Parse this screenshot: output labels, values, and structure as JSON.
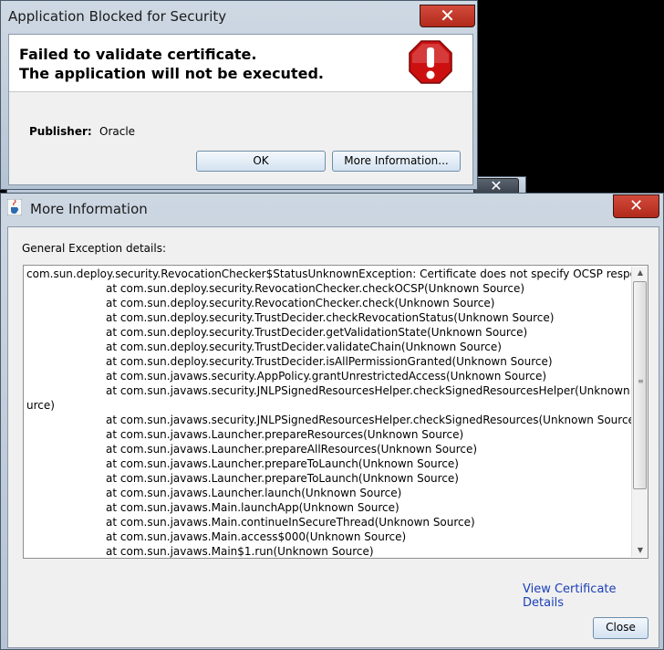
{
  "blocked_dialog": {
    "title": "Application Blocked for Security",
    "close_glyph": "✕",
    "heading_line1": "Failed to validate certificate.",
    "heading_line2": "The application will not be executed.",
    "icon": "stop-warning-icon",
    "publisher_label": "Publisher:",
    "publisher_value": "Oracle",
    "ok_label": "OK",
    "more_info_label": "More Information..."
  },
  "background_window": {
    "close_glyph": "✕"
  },
  "more_info_dialog": {
    "title": "More Information",
    "icon": "java-cup-icon",
    "close_glyph": "✕",
    "details_label": "General Exception details:",
    "trace_lines": [
      {
        "text": "com.sun.deploy.security.RevocationChecker$StatusUnknownException: Certificate does not specify OCSP responder",
        "indent": false
      },
      {
        "text": "at com.sun.deploy.security.RevocationChecker.checkOCSP(Unknown Source)",
        "indent": true
      },
      {
        "text": "at com.sun.deploy.security.RevocationChecker.check(Unknown Source)",
        "indent": true
      },
      {
        "text": "at com.sun.deploy.security.TrustDecider.checkRevocationStatus(Unknown Source)",
        "indent": true
      },
      {
        "text": "at com.sun.deploy.security.TrustDecider.getValidationState(Unknown Source)",
        "indent": true
      },
      {
        "text": "at com.sun.deploy.security.TrustDecider.validateChain(Unknown Source)",
        "indent": true
      },
      {
        "text": "at com.sun.deploy.security.TrustDecider.isAllPermissionGranted(Unknown Source)",
        "indent": true
      },
      {
        "text": "at com.sun.javaws.security.AppPolicy.grantUnrestrictedAccess(Unknown Source)",
        "indent": true
      },
      {
        "text": "at com.sun.javaws.security.JNLPSignedResourcesHelper.checkSignedResourcesHelper(Unknown So",
        "indent": true
      },
      {
        "text": "urce)",
        "indent": false
      },
      {
        "text": "at com.sun.javaws.security.JNLPSignedResourcesHelper.checkSignedResources(Unknown Source)",
        "indent": true
      },
      {
        "text": "at com.sun.javaws.Launcher.prepareResources(Unknown Source)",
        "indent": true
      },
      {
        "text": "at com.sun.javaws.Launcher.prepareAllResources(Unknown Source)",
        "indent": true
      },
      {
        "text": "at com.sun.javaws.Launcher.prepareToLaunch(Unknown Source)",
        "indent": true
      },
      {
        "text": "at com.sun.javaws.Launcher.prepareToLaunch(Unknown Source)",
        "indent": true
      },
      {
        "text": "at com.sun.javaws.Launcher.launch(Unknown Source)",
        "indent": true
      },
      {
        "text": "at com.sun.javaws.Main.launchApp(Unknown Source)",
        "indent": true
      },
      {
        "text": "at com.sun.javaws.Main.continueInSecureThread(Unknown Source)",
        "indent": true
      },
      {
        "text": "at com.sun.javaws.Main.access$000(Unknown Source)",
        "indent": true
      },
      {
        "text": "at com.sun.javaws.Main$1.run(Unknown Source)",
        "indent": true
      }
    ],
    "scroll_up_glyph": "▲",
    "scroll_down_glyph": "▼",
    "view_cert_label": "View Certificate Details",
    "close_label": "Close"
  },
  "colors": {
    "link": "#1a3fb8",
    "close_button_red": "#c7392b",
    "stop_icon_red": "#cc1010"
  }
}
